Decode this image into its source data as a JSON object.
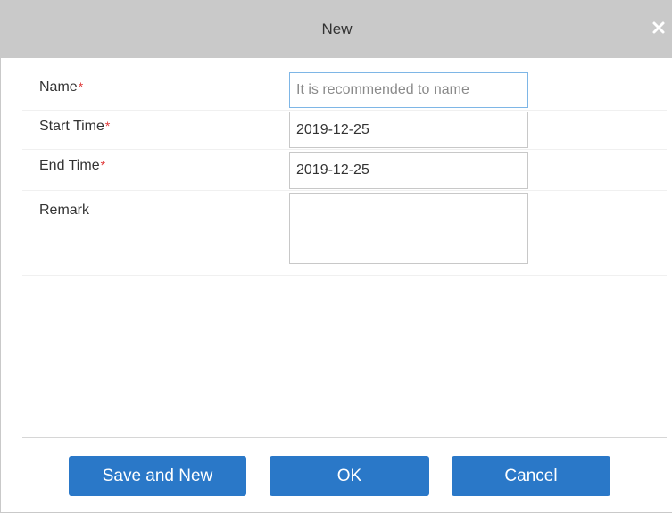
{
  "dialog": {
    "title": "New",
    "close_icon": "close-icon"
  },
  "form": {
    "required_marker": "*",
    "name": {
      "label": "Name",
      "value": "",
      "placeholder": "It is recommended to name"
    },
    "start_time": {
      "label": "Start Time",
      "value": "2019-12-25"
    },
    "end_time": {
      "label": "End Time",
      "value": "2019-12-25"
    },
    "remark": {
      "label": "Remark",
      "value": ""
    }
  },
  "buttons": {
    "save_and_new": "Save and New",
    "ok": "OK",
    "cancel": "Cancel"
  },
  "colors": {
    "title_bar": "#c9c9c9",
    "button": "#2a78c8",
    "required": "#e03a3a"
  }
}
